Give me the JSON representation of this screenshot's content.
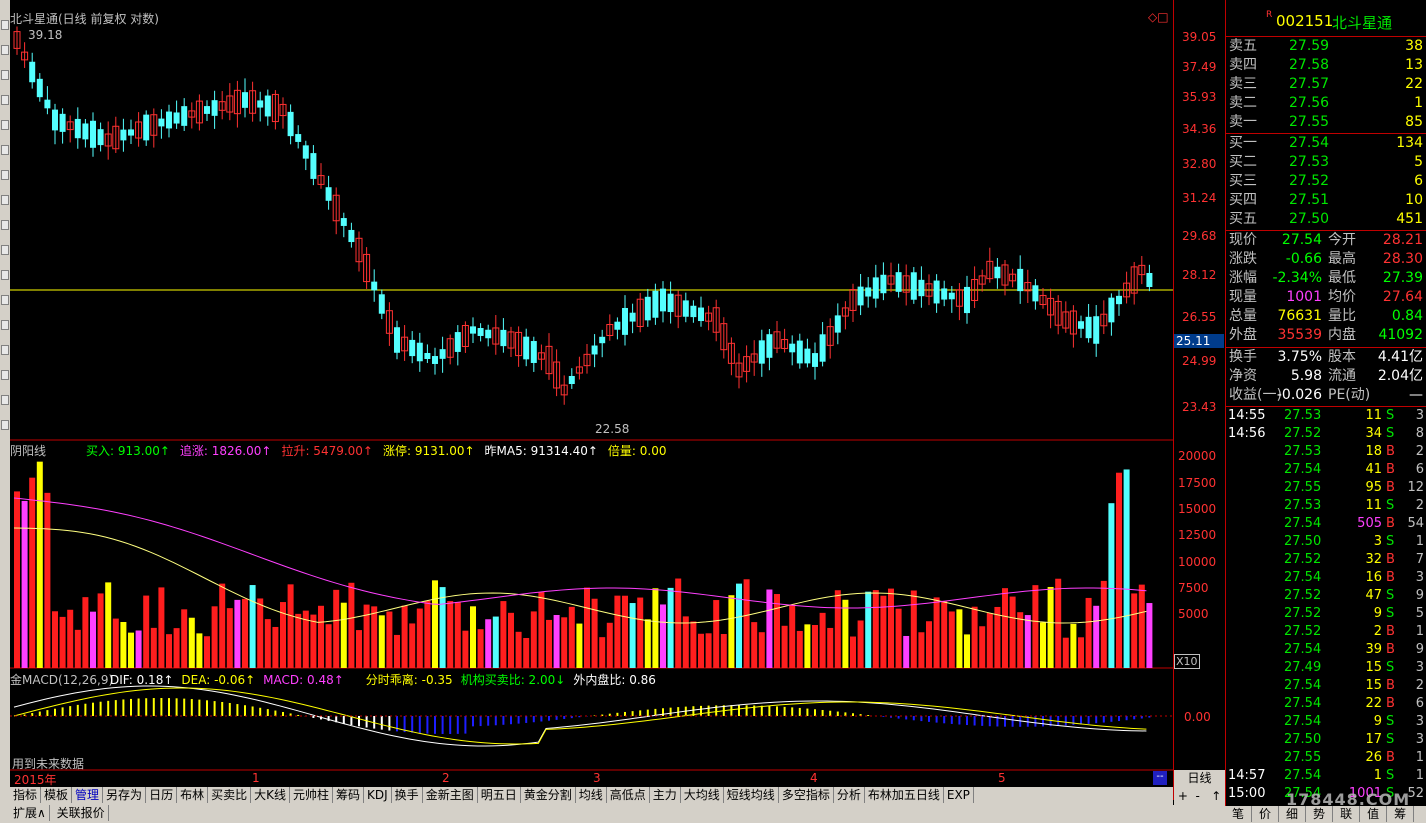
{
  "stock": {
    "code": "002151",
    "name": "北斗星通",
    "r_badge": "R"
  },
  "main_chart": {
    "title": "北斗星通(日线 前复权 对数)",
    "max_label": "39.18",
    "min_label": "22.58",
    "price_axis": [
      "39.05",
      "37.49",
      "35.93",
      "34.36",
      "32.80",
      "31.24",
      "29.68",
      "28.12",
      "26.55",
      "24.99",
      "23.43"
    ],
    "current_price_tag": "25.11",
    "corner_icons": "◇□"
  },
  "volume_indicator": {
    "name": "阴阳线",
    "items": [
      {
        "label": "买入: 913.00↑",
        "color": "#00ff00"
      },
      {
        "label": "追涨: 1826.00↑",
        "color": "#ff40ff"
      },
      {
        "label": "拉升: 5479.00↑",
        "color": "#ff3232"
      },
      {
        "label": "涨停: 9131.00↑",
        "color": "#ffff00"
      },
      {
        "label": "昨MA5: 91314.40↑",
        "color": "#ffffff"
      },
      {
        "label": "倍量: 0.00",
        "color": "#ffff00"
      }
    ],
    "axis": [
      "20000",
      "17500",
      "15000",
      "12500",
      "10000",
      "7500",
      "5000"
    ],
    "unit": "X10"
  },
  "macd_indicator": {
    "name": "金MACD(12,26,9)",
    "items": [
      {
        "label": "DIF: 0.18↑",
        "color": "#ffffff"
      },
      {
        "label": "DEA: -0.06↑",
        "color": "#ffff00"
      },
      {
        "label": "MACD: 0.48↑",
        "color": "#ff40ff"
      },
      {
        "label": "分时乖离: -0.35",
        "color": "#ffff00"
      },
      {
        "label": "机构买卖比: 2.00↓",
        "color": "#00ff00"
      },
      {
        "label": "外内盘比: 0.86",
        "color": "#ffffff"
      }
    ],
    "zero_label": "0.00",
    "future_note": "用到未来数据"
  },
  "time_axis": [
    "2015年",
    "1",
    "2",
    "3",
    "4",
    "5"
  ],
  "period_label": "日线",
  "bottom_tabs": [
    "指标",
    "模板",
    "管理",
    "另存为",
    "日历",
    "布林",
    "买卖比",
    "大K线",
    "元帅柱",
    "筹码",
    "KDJ",
    "换手",
    "金新主图",
    "明五日",
    "黄金分割",
    "均线",
    "高低点",
    "主力",
    "大均线",
    "短线均线",
    "多空指标",
    "分析",
    "布林加五日线",
    "EXP"
  ],
  "active_tab": "管理",
  "bottom_bar2": [
    "扩展∧",
    "关联报价"
  ],
  "order_book": {
    "asks": [
      {
        "label": "卖五",
        "price": "27.59",
        "vol": "38"
      },
      {
        "label": "卖四",
        "price": "27.58",
        "vol": "13"
      },
      {
        "label": "卖三",
        "price": "27.57",
        "vol": "22"
      },
      {
        "label": "卖二",
        "price": "27.56",
        "vol": "1"
      },
      {
        "label": "卖一",
        "price": "27.55",
        "vol": "85"
      }
    ],
    "bids": [
      {
        "label": "买一",
        "price": "27.54",
        "vol": "134"
      },
      {
        "label": "买二",
        "price": "27.53",
        "vol": "5"
      },
      {
        "label": "买三",
        "price": "27.52",
        "vol": "6"
      },
      {
        "label": "买四",
        "price": "27.51",
        "vol": "10"
      },
      {
        "label": "买五",
        "price": "27.50",
        "vol": "451"
      }
    ]
  },
  "quote": [
    {
      "l1": "现价",
      "v1": "27.54",
      "c1": "#00ff00",
      "l2": "今开",
      "v2": "28.21",
      "c2": "#ff3232"
    },
    {
      "l1": "涨跌",
      "v1": "-0.66",
      "c1": "#00ff00",
      "l2": "最高",
      "v2": "28.30",
      "c2": "#ff3232"
    },
    {
      "l1": "涨幅",
      "v1": "-2.34%",
      "c1": "#00ff00",
      "l2": "最低",
      "v2": "27.39",
      "c2": "#00ff00"
    },
    {
      "l1": "现量",
      "v1": "1001",
      "c1": "#ff40ff",
      "l2": "均价",
      "v2": "27.64",
      "c2": "#ff3232"
    },
    {
      "l1": "总量",
      "v1": "76631",
      "c1": "#ffff00",
      "l2": "量比",
      "v2": "0.84",
      "c2": "#00ff00"
    },
    {
      "l1": "外盘",
      "v1": "35539",
      "c1": "#ff3232",
      "l2": "内盘",
      "v2": "41092",
      "c2": "#00ff00"
    }
  ],
  "fundamentals": [
    {
      "l1": "换手",
      "v1": "3.75%",
      "l2": "股本",
      "v2": "4.41亿"
    },
    {
      "l1": "净资",
      "v1": "5.98",
      "l2": "流通",
      "v2": "2.04亿"
    },
    {
      "l1": "收益(一)",
      "v1": "-0.026",
      "l2": "PE(动)",
      "v2": "—"
    }
  ],
  "ticks": [
    {
      "time": "14:55",
      "price": "27.53",
      "vol": "11",
      "side": "S",
      "n": "3"
    },
    {
      "time": "14:56",
      "price": "27.52",
      "vol": "34",
      "side": "S",
      "n": "8"
    },
    {
      "time": "",
      "price": "27.53",
      "vol": "18",
      "side": "B",
      "n": "2"
    },
    {
      "time": "",
      "price": "27.54",
      "vol": "41",
      "side": "B",
      "n": "6"
    },
    {
      "time": "",
      "price": "27.55",
      "vol": "95",
      "side": "B",
      "n": "12"
    },
    {
      "time": "",
      "price": "27.53",
      "vol": "11",
      "side": "S",
      "n": "2"
    },
    {
      "time": "",
      "price": "27.54",
      "vol": "505",
      "side": "B",
      "n": "54"
    },
    {
      "time": "",
      "price": "27.50",
      "vol": "3",
      "side": "S",
      "n": "1"
    },
    {
      "time": "",
      "price": "27.52",
      "vol": "32",
      "side": "B",
      "n": "7"
    },
    {
      "time": "",
      "price": "27.54",
      "vol": "16",
      "side": "B",
      "n": "3"
    },
    {
      "time": "",
      "price": "27.52",
      "vol": "47",
      "side": "S",
      "n": "9"
    },
    {
      "time": "",
      "price": "27.52",
      "vol": "9",
      "side": "S",
      "n": "5"
    },
    {
      "time": "",
      "price": "27.52",
      "vol": "2",
      "side": "B",
      "n": "1"
    },
    {
      "time": "",
      "price": "27.54",
      "vol": "39",
      "side": "B",
      "n": "9"
    },
    {
      "time": "",
      "price": "27.49",
      "vol": "15",
      "side": "S",
      "n": "3"
    },
    {
      "time": "",
      "price": "27.54",
      "vol": "15",
      "side": "B",
      "n": "2"
    },
    {
      "time": "",
      "price": "27.54",
      "vol": "22",
      "side": "B",
      "n": "6"
    },
    {
      "time": "",
      "price": "27.54",
      "vol": "9",
      "side": "S",
      "n": "3"
    },
    {
      "time": "",
      "price": "27.50",
      "vol": "17",
      "side": "S",
      "n": "3"
    },
    {
      "time": "",
      "price": "27.55",
      "vol": "26",
      "side": "B",
      "n": "1"
    },
    {
      "time": "14:57",
      "price": "27.54",
      "vol": "1",
      "side": "S",
      "n": "1"
    },
    {
      "time": "15:00",
      "price": "27.54",
      "vol": "1001",
      "side": "S",
      "n": "52"
    }
  ],
  "rp_tabs": [
    "笔",
    "价",
    "细",
    "势",
    "联",
    "值",
    "筹"
  ],
  "watermark": "178448.COM"
}
